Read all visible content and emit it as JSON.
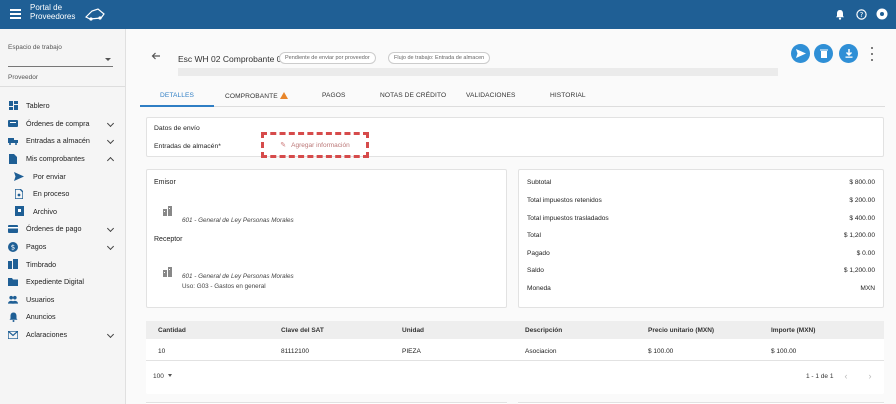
{
  "topbar": {
    "logo_line1": "Portal de",
    "logo_line2": "Proveedores",
    "colors": {
      "bar": "#1f5f95",
      "accent": "#2f8fd6"
    }
  },
  "sidebar": {
    "workspace_label": "Espacio de trabajo",
    "workspace_value": "",
    "provider_label": "Proveedor",
    "items": [
      {
        "label": "Tablero",
        "icon": "dashboard-icon",
        "expandable": false
      },
      {
        "label": "Órdenes de compra",
        "icon": "cart-icon",
        "expandable": true,
        "expanded": false
      },
      {
        "label": "Entradas a almacén",
        "icon": "truck-icon",
        "expandable": true,
        "expanded": false
      },
      {
        "label": "Mis comprobantes",
        "icon": "document-icon",
        "expandable": true,
        "expanded": true
      },
      {
        "label": "Por enviar",
        "icon": "send-icon",
        "sub": true
      },
      {
        "label": "En proceso",
        "icon": "file-progress-icon",
        "sub": true
      },
      {
        "label": "Archivo",
        "icon": "archive-icon",
        "sub": true
      },
      {
        "label": "Órdenes de pago",
        "icon": "card-icon",
        "expandable": true,
        "expanded": false
      },
      {
        "label": "Pagos",
        "icon": "money-icon",
        "expandable": true,
        "expanded": false
      },
      {
        "label": "Timbrado",
        "icon": "building-icon",
        "expandable": false
      },
      {
        "label": "Expediente Digital",
        "icon": "folder-icon",
        "expandable": false
      },
      {
        "label": "Usuarios",
        "icon": "users-icon",
        "expandable": false
      },
      {
        "label": "Anuncios",
        "icon": "bell-icon",
        "expandable": false
      },
      {
        "label": "Aclaraciones",
        "icon": "mail-icon",
        "expandable": true,
        "expanded": false
      }
    ]
  },
  "header": {
    "title": "Esc WH 02 Comprobante 01",
    "status_chip": "Pendiente de enviar por proveedor",
    "flow_chip": "Flujo de trabajo: Entrada de almacen"
  },
  "tabs": [
    {
      "label": "DETALLES",
      "active": true
    },
    {
      "label": "COMPROBANTE",
      "active": false,
      "warning": true
    },
    {
      "label": "PAGOS",
      "active": false
    },
    {
      "label": "NOTAS DE CRÉDITO",
      "active": false
    },
    {
      "label": "VALIDACIONES",
      "active": false
    },
    {
      "label": "HISTORIAL",
      "active": false
    }
  ],
  "envio": {
    "section_label": "Datos de envío",
    "entradas_label": "Entradas de almacén*",
    "add_button": "Agregar información"
  },
  "partes": {
    "emisor_label": "Emisor",
    "emisor_regimen": "601 - General de Ley Personas Morales",
    "receptor_label": "Receptor",
    "receptor_regimen": "601 - General de Ley Personas Morales",
    "receptor_uso": "Uso: G03 - Gastos en general"
  },
  "totales": [
    {
      "label": "Subtotal",
      "value": "$ 800.00"
    },
    {
      "label": "Total impuestos retenidos",
      "value": "$ 200.00"
    },
    {
      "label": "Total impuestos trasladados",
      "value": "$ 400.00"
    },
    {
      "label": "Total",
      "value": "$ 1,200.00"
    },
    {
      "label": "Pagado",
      "value": "$ 0.00"
    },
    {
      "label": "Saldo",
      "value": "$ 1,200.00"
    },
    {
      "label": "Moneda",
      "value": "MXN"
    }
  ],
  "conceptos": {
    "columns": [
      "Cantidad",
      "Clave del SAT",
      "Unidad",
      "Descripción",
      "Precio unitario (MXN)",
      "Importe (MXN)"
    ],
    "rows": [
      [
        "10",
        "81112100",
        "PIEZA",
        "Asociacion",
        "$ 100.00",
        "$ 100.00"
      ]
    ],
    "page_size": "100",
    "page_info": "1 - 1 de 1"
  }
}
